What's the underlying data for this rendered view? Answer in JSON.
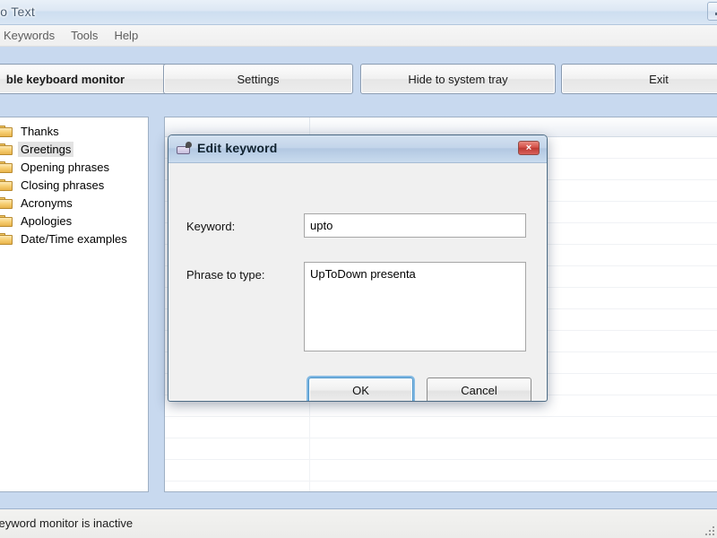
{
  "window": {
    "title": "to Text",
    "minimize_icon": "minimize-icon"
  },
  "menubar": {
    "items": [
      {
        "label": "",
        "name": "menu-item-clipped"
      },
      {
        "label": "Keywords",
        "name": "menu-item-keywords"
      },
      {
        "label": "Tools",
        "name": "menu-item-tools"
      },
      {
        "label": "Help",
        "name": "menu-item-help"
      }
    ]
  },
  "toolbar": {
    "enable_label": "ble keyboard monitor",
    "settings_label": "Settings",
    "hide_label": "Hide to system tray",
    "exit_label": "Exit"
  },
  "tree": {
    "items": [
      {
        "label": "Thanks",
        "selected": false
      },
      {
        "label": "Greetings",
        "selected": true
      },
      {
        "label": "Opening phrases",
        "selected": false
      },
      {
        "label": "Closing phrases",
        "selected": false
      },
      {
        "label": "Acronyms",
        "selected": false
      },
      {
        "label": "Apologies",
        "selected": false
      },
      {
        "label": "Date/Time examples",
        "selected": false
      }
    ]
  },
  "listview": {
    "columns": [
      "",
      ""
    ],
    "rows": []
  },
  "dialog": {
    "title": "Edit keyword",
    "icon": "keyboard-edit-icon",
    "close_label": "×",
    "keyword_label": "Keyword:",
    "keyword_value": "upto",
    "phrase_label": "Phrase to type:",
    "phrase_value": "UpToDown presenta",
    "ok_label": "OK",
    "cancel_label": "Cancel"
  },
  "statusbar": {
    "text": "keyword monitor is inactive"
  },
  "colors": {
    "window_bg": "#c8d9ef",
    "dialog_bg": "#f0f0f0",
    "accent_focus": "#6eafe0",
    "close_red": "#bd3a33",
    "folder": "#f2c965"
  }
}
